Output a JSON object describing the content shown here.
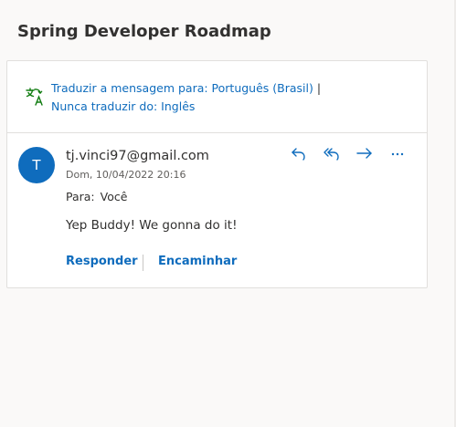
{
  "message": {
    "subject": "Spring Developer Roadmap",
    "translate": {
      "translate_link": "Traduzir a mensagem para: Português (Brasil)",
      "separator": "|",
      "never_link": "Nunca traduzir do: Inglês",
      "icon": "translate-icon"
    },
    "sender": {
      "initial": "T",
      "email": "tj.vinci97@gmail.com",
      "date": "Dom, 10/04/2022 20:16",
      "avatar_color": "#0f6cbd"
    },
    "to": {
      "label": "Para:",
      "value": "Você"
    },
    "actions": [
      {
        "name": "reply",
        "icon": "reply-icon"
      },
      {
        "name": "reply-all",
        "icon": "reply-all-icon"
      },
      {
        "name": "forward",
        "icon": "forward-icon"
      },
      {
        "name": "more",
        "icon": "more-icon"
      }
    ],
    "body": "Yep Buddy! We gonna do it!",
    "footer": {
      "reply_label": "Responder",
      "forward_label": "Encaminhar"
    }
  },
  "colors": {
    "accent": "#0f6cbd",
    "translate_icon": "#107c10",
    "text": "#323130",
    "muted": "#605e5c"
  }
}
